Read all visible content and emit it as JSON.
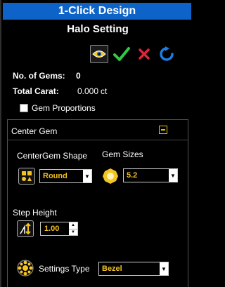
{
  "panel": {
    "title": "1-Click Design",
    "subtitle": "Halo Setting"
  },
  "toolbar": {
    "icons": [
      "eye-icon",
      "check-icon",
      "close-icon",
      "refresh-icon"
    ],
    "colors": {
      "check": "#2ecc40",
      "close": "#e0243a",
      "refresh": "#1e7be0"
    }
  },
  "stats": {
    "gems_label": "No. of Gems:",
    "gems_value": "0",
    "carat_label": "Total Carat:",
    "carat_value": "0.000",
    "carat_unit": "ct"
  },
  "gem_proportions": {
    "label": "Gem Proportions",
    "checked": false
  },
  "center_gem": {
    "title": "Center Gem",
    "shape_label": "CenterGem Shape",
    "shape_value": "Round",
    "sizes_label": "Gem Sizes",
    "size_value": "5.2",
    "step_label": "Step Height",
    "step_value": "1.00",
    "settings_label": "Settings Type",
    "settings_value": "Bezel"
  },
  "colors": {
    "title_bar": "#0e63c8",
    "value_text": "#f0c020"
  }
}
